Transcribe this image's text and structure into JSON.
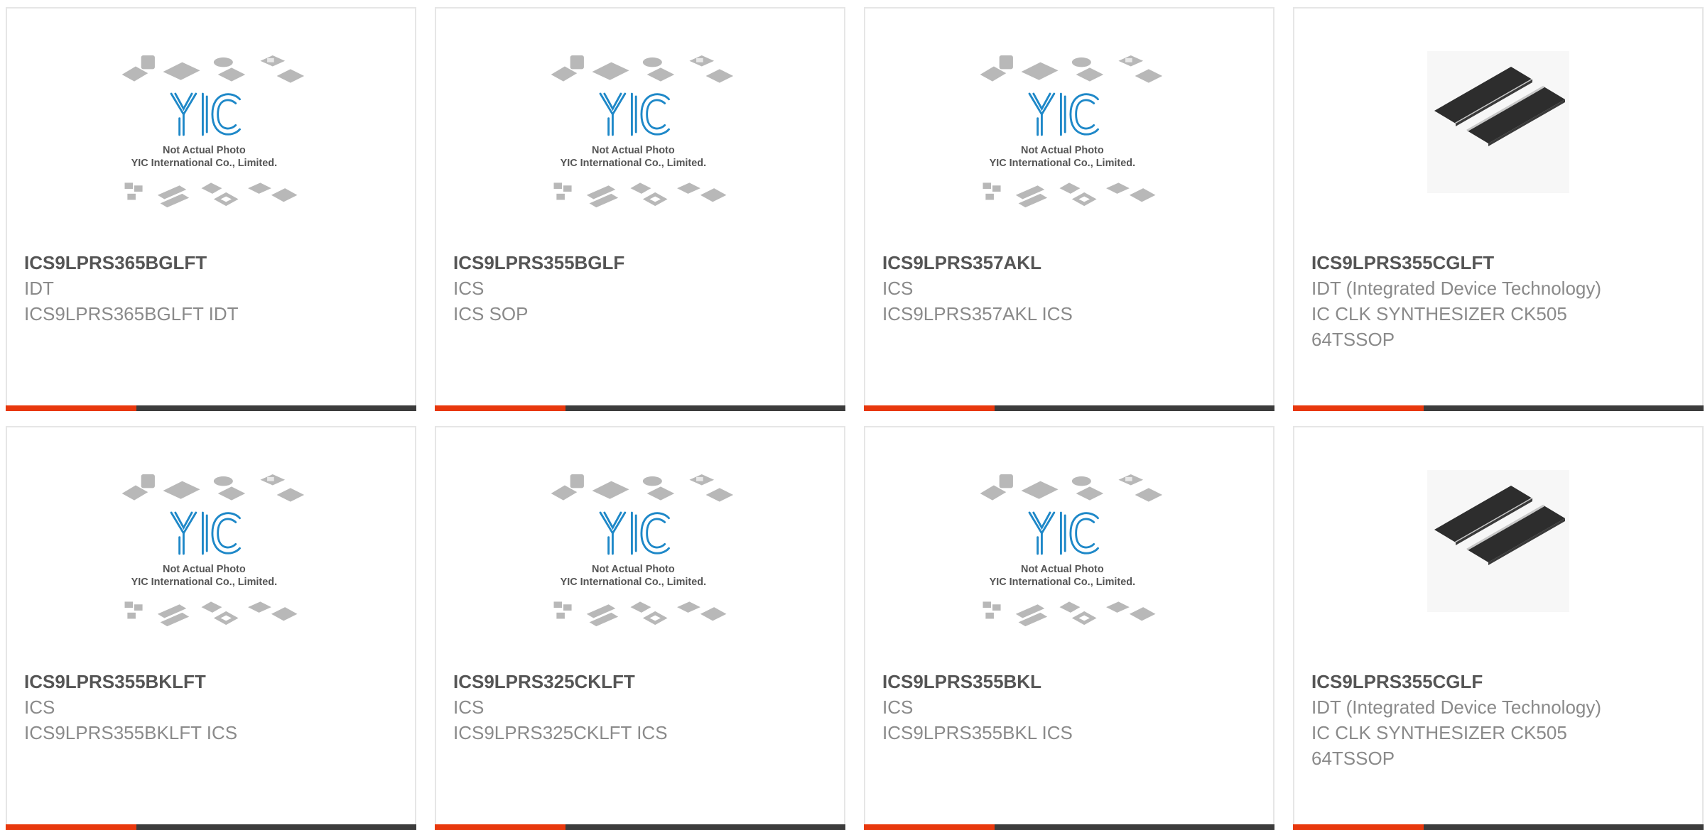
{
  "placeholder": {
    "line1": "Not Actual Photo",
    "line2": "YIC International Co., Limited.",
    "logo_text": "YIC"
  },
  "colors": {
    "accent": "#e8380d",
    "bar": "#3c3c3c",
    "logo_blue": "#1e88c8",
    "chip_gray": "#b8b8b8",
    "chip_dark": "#2d2d2d"
  },
  "products": [
    {
      "part": "ICS9LPRS365BGLFT",
      "brand": "IDT",
      "desc": "ICS9LPRS365BGLFT IDT",
      "image": "placeholder"
    },
    {
      "part": "ICS9LPRS355BGLF",
      "brand": "ICS",
      "desc": "ICS SOP",
      "image": "placeholder"
    },
    {
      "part": "ICS9LPRS357AKL",
      "brand": "ICS",
      "desc": "ICS9LPRS357AKL ICS",
      "image": "placeholder"
    },
    {
      "part": "ICS9LPRS355CGLFT",
      "brand": "IDT (Integrated Device Technology)",
      "desc": "IC CLK SYNTHESIZER CK505 64TSSOP",
      "image": "tssop-chips"
    },
    {
      "part": "ICS9LPRS355BKLFT",
      "brand": "ICS",
      "desc": "ICS9LPRS355BKLFT ICS",
      "image": "placeholder"
    },
    {
      "part": "ICS9LPRS325CKLFT",
      "brand": "ICS",
      "desc": "ICS9LPRS325CKLFT ICS",
      "image": "placeholder"
    },
    {
      "part": "ICS9LPRS355BKL",
      "brand": "ICS",
      "desc": "ICS9LPRS355BKL ICS",
      "image": "placeholder"
    },
    {
      "part": "ICS9LPRS355CGLF",
      "brand": "IDT (Integrated Device Technology)",
      "desc": "IC CLK SYNTHESIZER CK505 64TSSOP",
      "image": "tssop-chips"
    }
  ]
}
